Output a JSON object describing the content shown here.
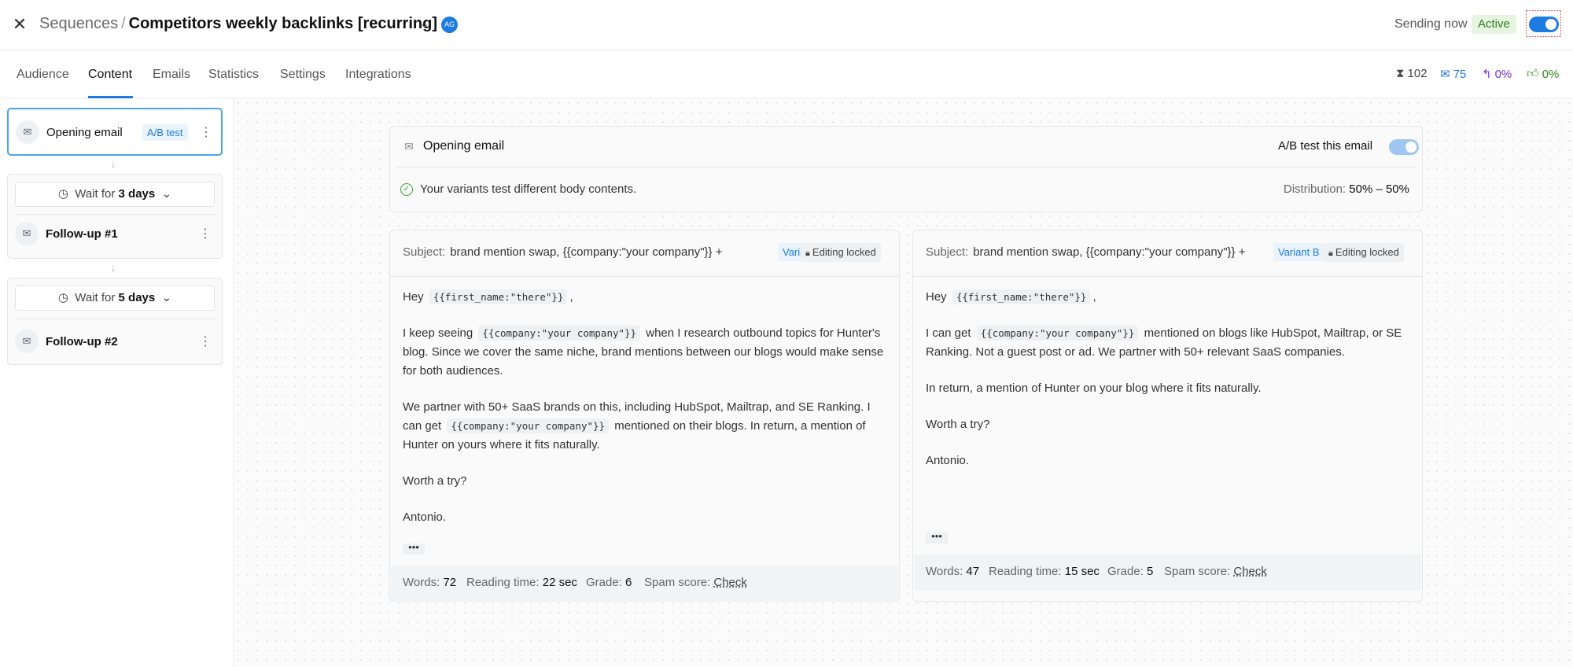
{
  "header": {
    "breadcrumb_root": "Sequences",
    "separator": "/",
    "title": "Competitors weekly backlinks [recurring]",
    "avatar_initials": "AG",
    "sending_status": "Sending now",
    "active_label": "Active"
  },
  "tabs": [
    {
      "label": "Audience"
    },
    {
      "label": "Content"
    },
    {
      "label": "Emails"
    },
    {
      "label": "Statistics"
    },
    {
      "label": "Settings"
    },
    {
      "label": "Integrations"
    }
  ],
  "stats": {
    "queued": "102",
    "sent": "75",
    "replied": "0%",
    "interested": "0%"
  },
  "sidebar": {
    "opening": {
      "label": "Opening email",
      "tag": "A/B test"
    },
    "wait1": {
      "prefix": "Wait for",
      "value": "3 days"
    },
    "followup1": {
      "label": "Follow-up #1"
    },
    "wait2": {
      "prefix": "Wait for",
      "value": "5 days"
    },
    "followup2": {
      "label": "Follow-up #2"
    }
  },
  "header_card": {
    "title": "Opening email",
    "ab_label": "A/B test this email",
    "message": "Your variants test different body contents.",
    "distribution_label": "Distribution:",
    "distribution_value": "50% – 50%"
  },
  "variant_a": {
    "subject_label": "Subject:",
    "subject": "brand mention swap, {{company:\"your company\"}} +",
    "tag": "Variant A",
    "lock": "Editing locked",
    "greeting": "Hey",
    "var_first_name": "{{first_name:\"there\"}}",
    "p1_a": "I keep seeing",
    "var_company": "{{company:\"your company\"}}",
    "p1_b": "when I research outbound topics for Hunter's blog. Since we cover the same niche, brand mentions between our blogs would make sense for both audiences.",
    "p2_a": "We partner with 50+ SaaS brands on this, including HubSpot, Mailtrap, and SE Ranking. I can get",
    "p2_b": "mentioned on their blogs. In return, a mention of Hunter on yours where it fits naturally.",
    "p3": "Worth a try?",
    "p4": "Antonio.",
    "words_label": "Words:",
    "words": "72",
    "reading_label": "Reading time:",
    "reading": "22 sec",
    "grade_label": "Grade:",
    "grade": "6",
    "spam_label": "Spam score:",
    "spam": "Check"
  },
  "variant_b": {
    "subject_label": "Subject:",
    "subject": "brand mention swap, {{company:\"your company\"}} +",
    "tag": "Variant B",
    "lock": "Editing locked",
    "greeting": "Hey",
    "var_first_name": "{{first_name:\"there\"}}",
    "p1_a": "I can get",
    "var_company": "{{company:\"your company\"}}",
    "p1_b": "mentioned on blogs like HubSpot, Mailtrap, or SE Ranking. Not a guest post or ad. We partner with 50+ relevant SaaS companies.",
    "p2": "In return, a mention of Hunter on your blog where it fits naturally.",
    "p3": "Worth a try?",
    "p4": "Antonio.",
    "words_label": "Words:",
    "words": "47",
    "reading_label": "Reading time:",
    "reading": "15 sec",
    "grade_label": "Grade:",
    "grade": "5",
    "spam_label": "Spam score:",
    "spam": "Check"
  },
  "colors": {
    "accent": "#1e7be0",
    "active_bg": "#e6f5e2",
    "active_text": "#2f7d1a",
    "replied": "#7b2fd1",
    "interested": "#2f8a1a"
  }
}
